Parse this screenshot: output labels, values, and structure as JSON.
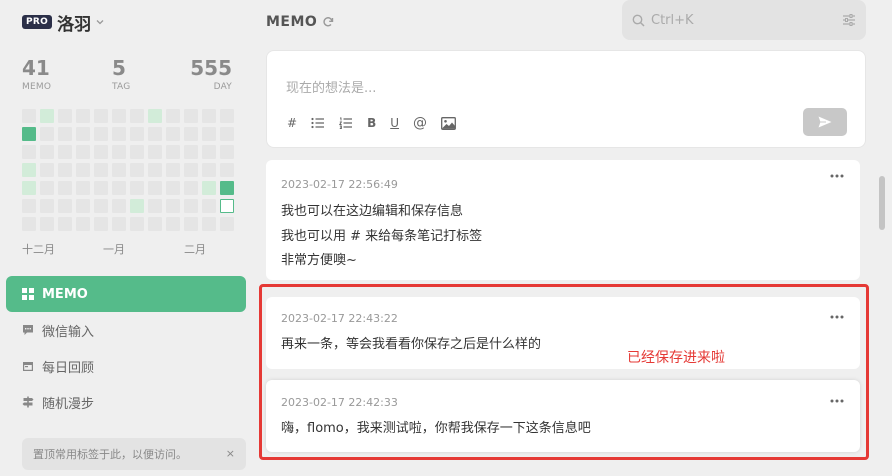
{
  "user": {
    "badge": "PRO",
    "name": "洛羽"
  },
  "stats": [
    {
      "value": "41",
      "label": "MEMO"
    },
    {
      "value": "5",
      "label": "TAG"
    },
    {
      "value": "555",
      "label": "DAY"
    }
  ],
  "heatmap": {
    "rows": [
      [
        0,
        1,
        0,
        0,
        0,
        0,
        0,
        1,
        0,
        0,
        0,
        0
      ],
      [
        3,
        0,
        0,
        0,
        0,
        0,
        0,
        0,
        0,
        0,
        0,
        0
      ],
      [
        0,
        0,
        0,
        0,
        0,
        0,
        0,
        0,
        0,
        0,
        0,
        0
      ],
      [
        1,
        0,
        0,
        0,
        0,
        0,
        0,
        0,
        0,
        0,
        0,
        0
      ],
      [
        1,
        0,
        0,
        0,
        0,
        0,
        0,
        0,
        0,
        0,
        1,
        3
      ],
      [
        0,
        0,
        0,
        0,
        0,
        0,
        1,
        0,
        0,
        0,
        0,
        4
      ],
      [
        0,
        0,
        0,
        0,
        0,
        0,
        0,
        0,
        0,
        0,
        0,
        0
      ]
    ],
    "months": [
      "十二月",
      "一月",
      "二月"
    ]
  },
  "nav": {
    "items": [
      {
        "label": "MEMO",
        "icon": "grid-icon",
        "active": true
      },
      {
        "label": "微信输入",
        "icon": "chat-icon",
        "active": false
      },
      {
        "label": "每日回顾",
        "icon": "calendar-icon",
        "active": false
      },
      {
        "label": "随机漫步",
        "icon": "signpost-icon",
        "active": false
      }
    ]
  },
  "tip": {
    "text": "置顶常用标签于此，以便访问。",
    "close": "×"
  },
  "header": {
    "title": "MEMO"
  },
  "search": {
    "placeholder": "Ctrl+K"
  },
  "editor": {
    "placeholder": "现在的想法是...",
    "tools": [
      "#",
      "bullet-list-icon",
      "numbered-list-icon",
      "B",
      "U",
      "@",
      "image-icon"
    ]
  },
  "memos": [
    {
      "time": "2023-02-17 22:56:49",
      "lines": [
        "我也可以在这边编辑和保存信息",
        "我也可以用 # 来给每条笔记打标签",
        "非常方便噢~"
      ]
    },
    {
      "time": "2023-02-17 22:43:22",
      "lines": [
        "再来一条，等会我看看你保存之后是什么样的"
      ]
    },
    {
      "time": "2023-02-17 22:42:33",
      "lines": [
        "嗨，flomo，我来测试啦，你帮我保存一下这条信息吧"
      ]
    }
  ],
  "annotation": {
    "text": "已经保存进来啦"
  },
  "colors": {
    "accent": "#55bb8a",
    "badge": "#2b2f48",
    "highlight": "#e53935"
  }
}
